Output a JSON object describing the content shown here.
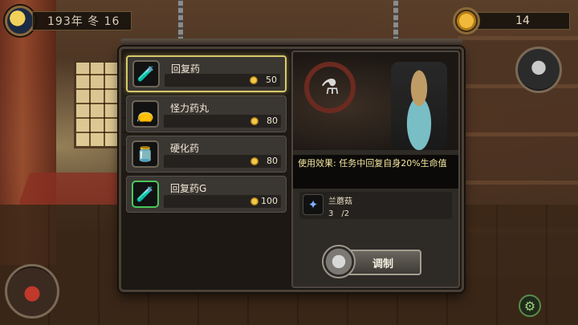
{
  "hud": {
    "date": "193年 冬 16",
    "gold": "14"
  },
  "recipes": [
    {
      "name": "回复药",
      "price": "50",
      "icon": "green-potion-icon",
      "selected": true
    },
    {
      "name": "怪力药丸",
      "price": "80",
      "icon": "pill-bag-icon",
      "selected": false
    },
    {
      "name": "硬化药",
      "price": "80",
      "icon": "jar-icon",
      "selected": false
    },
    {
      "name": "回复药G",
      "price": "100",
      "icon": "green-potion-icon",
      "selected": false
    }
  ],
  "detail": {
    "effect": "使用效果: 任务中回复自身20%生命值",
    "material": {
      "name": "兰蘑菇",
      "count": "3　/2",
      "icon": "blue-crystal-icon"
    },
    "craft_label": "调制"
  },
  "colors": {
    "selected_border": "#d7c96a",
    "highlight_border": "#48c85a",
    "effect_text": "#f6e7a0"
  }
}
